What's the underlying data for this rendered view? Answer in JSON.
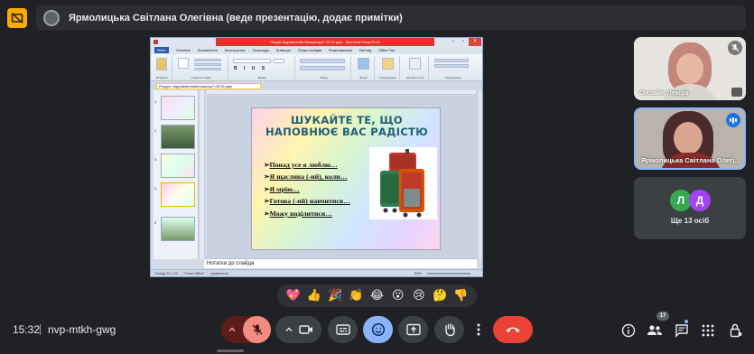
{
  "banner": {
    "presenter_text": "Ярмолицька Світлана Олегівна (веде презентацію, додає примітки)"
  },
  "ppt": {
    "window_title": "Ресурс відновлення Мельничук7.05.25.pptx - Microsoft PowerPoint",
    "tabs": [
      "Файл",
      "Основне",
      "Вставлення",
      "Конструктор",
      "Переходи",
      "Анімація",
      "Показ слайдів",
      "Рецензування",
      "Вигляд",
      "Office Tab"
    ],
    "ribbon_labels": [
      "Вставити",
      "Створити слайд",
      "Шрифт",
      "Абзац",
      "Фігури",
      "Упорядкувати",
      "Експрес-стилі",
      "Редагування"
    ],
    "doc_tab": "Ресурс і відновленняМельничук7.05.25.pptx",
    "thumb_numbers": [
      "1",
      "2",
      "3",
      "4",
      "5"
    ],
    "notes_placeholder": "Нотатки до слайда",
    "status_left": "Слайд 20 з 32",
    "status_theme": "\"Тема Office\"",
    "status_lang": "українська",
    "zoom": "59%"
  },
  "slide": {
    "title_line1": "ШУКАЙТЕ ТЕ, ЩО",
    "title_line2": "НАПОВНЮЄ ВАС РАДІСТЮ",
    "bullet": "➢",
    "items": [
      "Понад усе я люблю…",
      "Я щаслива (-ий), коли…",
      "Я мрію…",
      "Готова (-ий) навчитися…",
      "Можу поділитися…"
    ]
  },
  "tiles": {
    "t1_name": "Онлайн Лекція",
    "t2_name": "Ярмолицька Світлана Олегі...",
    "more_initial_1": "Л",
    "more_initial_2": "Д",
    "more_label": "Ще 13 осіб",
    "colors": {
      "l_avatar": "#34a853",
      "d_avatar": "#a142f4"
    }
  },
  "reactions": [
    "💖",
    "👍",
    "🎉",
    "👏",
    "😂",
    "😮",
    "😢",
    "🤔",
    "👎"
  ],
  "bottom": {
    "time": "15:32",
    "code": "nvp-mtkh-gwg",
    "people_count": "17"
  },
  "colors": {
    "background": "#202124",
    "leave": "#ea4335",
    "active_blue": "#8ab4f8",
    "mic_off": "#f28b82",
    "present_badge": "#f9ab00"
  }
}
